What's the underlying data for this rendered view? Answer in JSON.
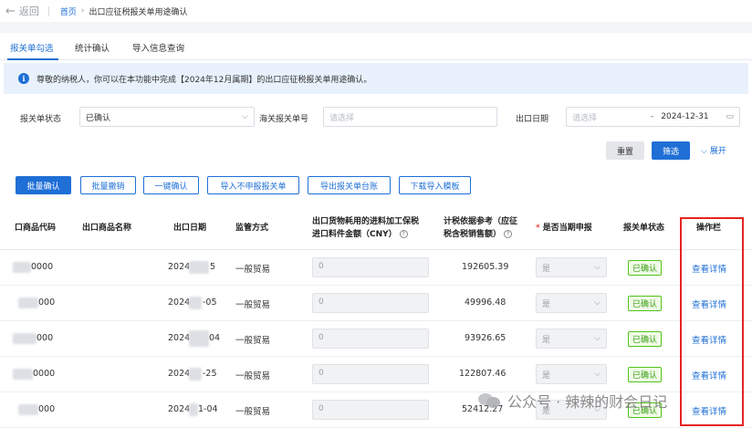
{
  "header": {
    "back_label": "返回",
    "breadcrumb": {
      "home": "首页",
      "separator": "›",
      "current": "出口应征税报关单用途确认"
    }
  },
  "tabs": [
    {
      "label": "报关单勾选",
      "active": true
    },
    {
      "label": "统计确认",
      "active": false
    },
    {
      "label": "导入信息查询",
      "active": false
    }
  ],
  "banner": {
    "text": "尊敬的纳税人，你可以在本功能中完成【2024年12月属期】的出口应征税报关单用途确认。"
  },
  "filters": {
    "status_label": "报关单状态",
    "status_value": "已确认",
    "customs_no_label": "海关报关单号",
    "customs_no_placeholder": "请选择",
    "date_label": "出口日期",
    "date_start_placeholder": "请选择",
    "date_sep": "-",
    "date_end": "2024-12-31"
  },
  "actions": {
    "reset": "重置",
    "search": "筛选",
    "expand": "展开",
    "batch_confirm": "批量确认",
    "batch_revoke": "批量撤销",
    "one_click_confirm": "一键确认",
    "import_not_declared": "导入不申报报关单",
    "export_ledger": "导出报关单台账",
    "download_template": "下载导入模板"
  },
  "table": {
    "headers": {
      "code": "口商品代码",
      "name": "出口商品名称",
      "date": "出口日期",
      "mode": "监管方式",
      "amount_line1": "出口货物耗用的进料加工保税",
      "amount_line2": "进口料件金额（CNY）",
      "basis_line1": "计税依据参考（应征",
      "basis_line2": "税含税销售额）",
      "current": "是否当期申报",
      "status": "报关单状态",
      "ops": "操作栏"
    },
    "rows": [
      {
        "code": "0000",
        "date": "2024",
        "date_tail": "5",
        "mode": "一般贸易",
        "amount": "0",
        "basis": "192605.39",
        "current": "是",
        "status": "已确认",
        "action": "查看详情"
      },
      {
        "code": "000",
        "date": "2024",
        "date_tail": "-05",
        "mode": "一般贸易",
        "amount": "0",
        "basis": "49996.48",
        "current": "是",
        "status": "已确认",
        "action": "查看详情"
      },
      {
        "code": "000",
        "date": "2024",
        "date_tail": "04",
        "mode": "一般贸易",
        "amount": "0",
        "basis": "93926.65",
        "current": "是",
        "status": "已确认",
        "action": "查看详情"
      },
      {
        "code": "0000",
        "date": "2024",
        "date_tail": "-25",
        "mode": "一般贸易",
        "amount": "0",
        "basis": "122807.46",
        "current": "是",
        "status": "已确认",
        "action": "查看详情"
      },
      {
        "code": "000",
        "date": "2024",
        "date_tail": "1-04",
        "mode": "一般贸易",
        "amount": "0",
        "basis": "52412.27",
        "current": "是",
        "status": "已确认",
        "action": "查看详情"
      }
    ]
  },
  "watermark": {
    "text": "公众号 · 辣辣的财会日记"
  },
  "colors": {
    "primary": "#1f6fd6",
    "success": "#52c41a",
    "highlight": "#e52421",
    "banner_bg": "#e8f1fc"
  }
}
